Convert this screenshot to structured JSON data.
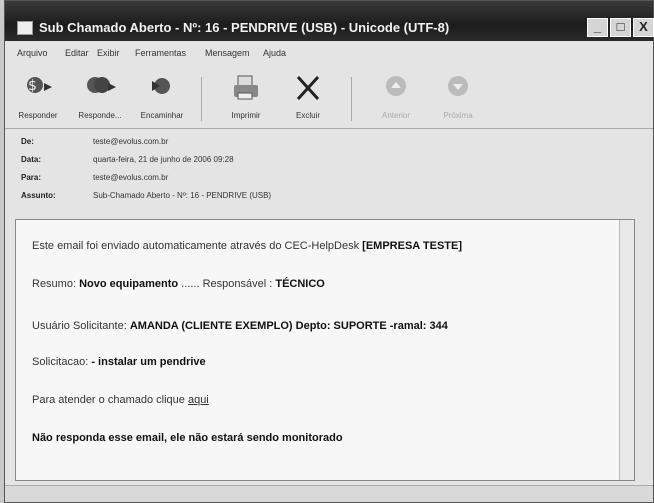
{
  "window": {
    "title": "Sub Chamado Aberto - Nº: 16 - PENDRIVE (USB) - Unicode (UTF-8)",
    "buttons": {
      "minimize": "_",
      "maximize": "□",
      "close": "X"
    }
  },
  "menu": [
    "Arquivo",
    "Editar",
    "Exibir",
    "Ferramentas",
    "Mensagem",
    "Ajuda"
  ],
  "toolbar": {
    "reply": "Responder",
    "reply_all": "Responde...",
    "forward": "Encaminhar",
    "print": "Imprimir",
    "delete": "Excluir",
    "previous": "Anterior",
    "next": "Próxima"
  },
  "headers": {
    "from_label": "De:",
    "from_value": "teste@evolus.com.br",
    "date_label": "Data:",
    "date_value": "quarta-feira, 21 de junho de 2006 09:28",
    "to_label": "Para:",
    "to_value": "teste@evolus.com.br",
    "subject_label": "Assunto:",
    "subject_value": "Sub-Chamado Aberto - Nº: 16 - PENDRIVE (USB)"
  },
  "body": {
    "intro_text": "Este email foi enviado automaticamente através do CEC-HelpDesk",
    "intro_company": "[EMPRESA TESTE]",
    "summary_label": "Resumo:",
    "summary_value": "Novo equipamento",
    "summary_dots": "......",
    "responsible_label": "Responsável :",
    "responsible_value": "TÉCNICO",
    "requester_label": "Usuário Solicitante:",
    "requester_value": "AMANDA (CLIENTE EXEMPLO) Depto: SUPORTE -ramal: 344",
    "request_label": "Solicitacao:",
    "request_value": "- instalar um pendrive",
    "attend_text": "Para atender o chamado clique",
    "attend_link": "aqui",
    "warning": "Não responda esse email, ele não estará sendo monitorado"
  }
}
